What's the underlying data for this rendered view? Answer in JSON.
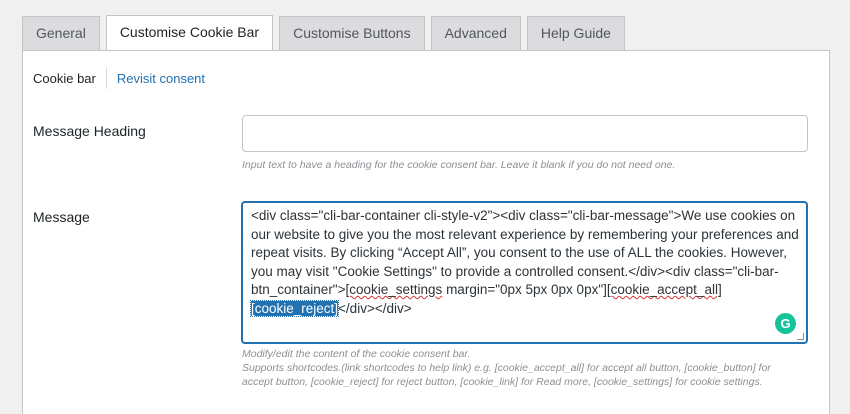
{
  "tabs": [
    {
      "label": "General"
    },
    {
      "label": "Customise Cookie Bar"
    },
    {
      "label": "Customise Buttons"
    },
    {
      "label": "Advanced"
    },
    {
      "label": "Help Guide"
    }
  ],
  "active_tab": "Customise Cookie Bar",
  "subnav": {
    "current": "Cookie bar",
    "link": "Revisit consent"
  },
  "message_heading": {
    "label": "Message Heading",
    "value": "",
    "hint": "Input text to have a heading for the cookie consent bar. Leave it blank if you do not need one."
  },
  "message": {
    "label": "Message",
    "text_part1": "<div class=\"cli-bar-container cli-style-v2\"><div class=\"cli-bar-message\">We use cookies on our website to give you the most relevant experience by remembering your preferences and repeat visits. By clicking “Accept All”, you consent to the use of ALL the cookies. However, you may visit \"Cookie Settings\" to provide a controlled consent.</div><div class=\"cli-bar-btn_container\">",
    "text_sc1": "[cookie_settings",
    "text_part2": " margin=\"0px 5px 0px 0px\"]",
    "text_sc2": "[cookie_accept_all]",
    "text_selected": "[cookie_reject]",
    "text_part3": "</div></div>",
    "hint_line1": "Modify/edit the content of the cookie consent bar.",
    "hint_line2": "Supports shortcodes.(link shortcodes to help link) e.g. [cookie_accept_all] for accept all button, [cookie_button] for accept button, [cookie_reject] for reject button, [cookie_link] for Read more, [cookie_settings] for cookie settings."
  },
  "grammarly_badge": "G",
  "colors": {
    "accent": "#2271b1",
    "grammarly": "#15c39a",
    "spellcheck": "#d63638"
  }
}
